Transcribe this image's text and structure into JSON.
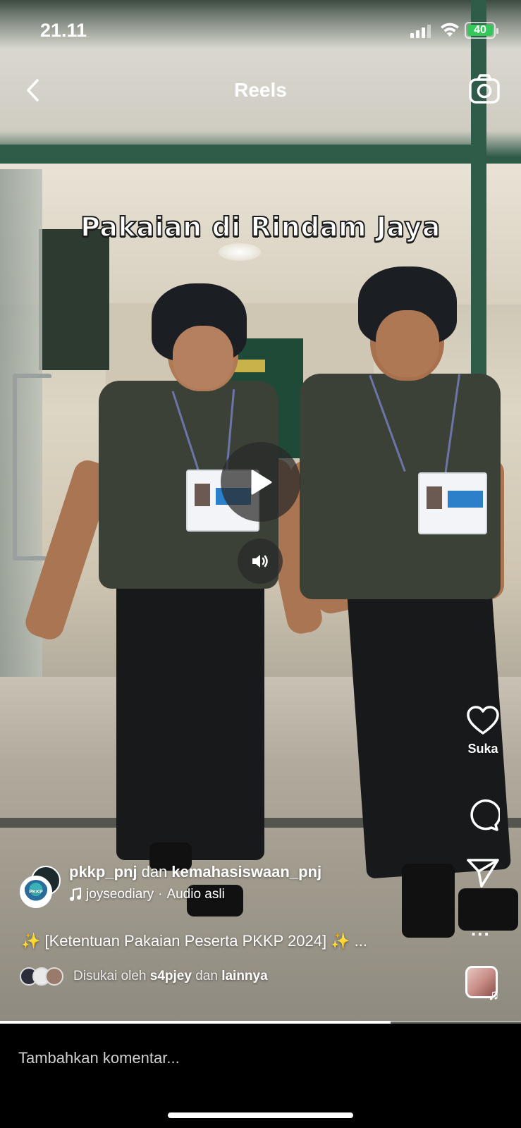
{
  "status_bar": {
    "time": "21.11",
    "battery": "40"
  },
  "header": {
    "title": "Reels",
    "back_icon": "chevron-left-icon",
    "camera_icon": "camera-icon"
  },
  "video": {
    "overlay_text": "Pakaian di Rindam Jaya",
    "state": "paused",
    "progress": 0.75
  },
  "actions": {
    "like_label": "Suka",
    "more_label": "..."
  },
  "post": {
    "author_1": "pkkp_pnj",
    "conjunction": "dan",
    "author_2": "kemahasiswaan_pnj",
    "avatar_text": "PKKP",
    "audio_user": "joyseodiary",
    "audio_separator": "·",
    "audio_name": "Audio asli",
    "caption": "✨ [Ketentuan Pakaian Peserta PKKP 2024] ✨ ...",
    "liked_prefix": "Disukai oleh",
    "liked_user": "s4pjey",
    "liked_conj": "dan",
    "liked_suffix": "lainnya"
  },
  "comment": {
    "placeholder": "Tambahkan komentar..."
  },
  "colors": {
    "background": "#000000",
    "battery_green": "#34c759",
    "text": "#ffffff"
  }
}
